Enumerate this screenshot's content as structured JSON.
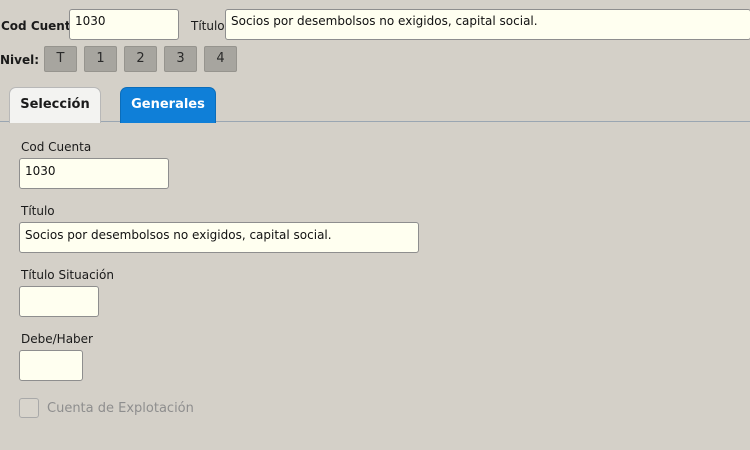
{
  "header": {
    "cod_cuenta_label": "Cod Cuenta",
    "cod_cuenta_value": "1030",
    "titulo_label": "Título",
    "titulo_value": "Socios por desembolsos no exigidos, capital social."
  },
  "nivel": {
    "label": "Nivel:",
    "buttons": [
      "T",
      "1",
      "2",
      "3",
      "4"
    ]
  },
  "tabs": [
    {
      "label": "Selección",
      "selected": true
    },
    {
      "label": "Generales",
      "selected": false
    }
  ],
  "form": {
    "cod_cuenta_label": "Cod Cuenta",
    "cod_cuenta_value": "1030",
    "titulo_label": "Título",
    "titulo_value": "Socios por desembolsos no exigidos, capital social.",
    "titulo_situacion_label": "Título Situación",
    "titulo_situacion_value": "",
    "debe_haber_label": "Debe/Haber",
    "debe_haber_value": "",
    "cuenta_explotacion_label": "Cuenta de Explotación",
    "cuenta_explotacion_checked": false
  },
  "colors": {
    "background": "#d4d0c8",
    "field_background": "#fffff0",
    "accent_tab": "#0f7fd8",
    "level_button": "#a7a59f"
  }
}
